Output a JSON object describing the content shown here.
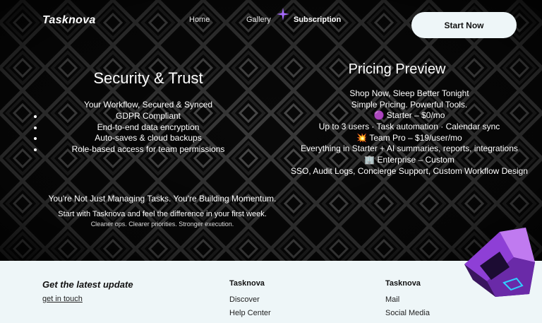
{
  "brand": {
    "logo": "Tasknova"
  },
  "nav": {
    "items": [
      "Home",
      "Gallery",
      "Subscription"
    ],
    "active": "Subscription"
  },
  "cta": {
    "label": "Start Now"
  },
  "security": {
    "title": "Security & Trust",
    "subtitle": "Your Workflow, Secured & Synced",
    "items": [
      "GDPR Compliant",
      "End-to-end data encryption",
      "Auto-saves & cloud backups",
      "Role-based access for team permissions"
    ]
  },
  "tagline": {
    "headline": "You're Not Just Managing Tasks. You're Building Momentum.",
    "body": "Start with Tasknova and feel the difference in your first week.",
    "small": "Cleaner ops. Clearer priorities. Stronger execution."
  },
  "pricing": {
    "title": "Pricing Preview",
    "lines": [
      "Shop Now,  Sleep Better Tonight",
      "Simple Pricing. Powerful Tools.",
      "🟣 Starter – $0/mo",
      "Up to 3 users · Task automation · Calendar sync",
      "💥 Team Pro – $19/user/mo",
      "Everything in Starter + AI summaries, reports, integrations",
      "🏢 Enterprise – Custom",
      "SSO, Audit Logs, Concierge Support, Custom Workflow Design"
    ]
  },
  "footer": {
    "newsletter_heading": "Get the latest update",
    "contact_link": "get in touch",
    "col1": {
      "title": "Tasknova",
      "items": [
        "Discover",
        "Help Center"
      ]
    },
    "col2": {
      "title": "Tasknova",
      "items": [
        "Mail",
        "Social Media"
      ]
    }
  },
  "colors": {
    "hero_bg": "#050505",
    "footer_bg": "#eef6f8",
    "accent": "#8a3fd0",
    "cta_bg": "#eef6f8"
  }
}
